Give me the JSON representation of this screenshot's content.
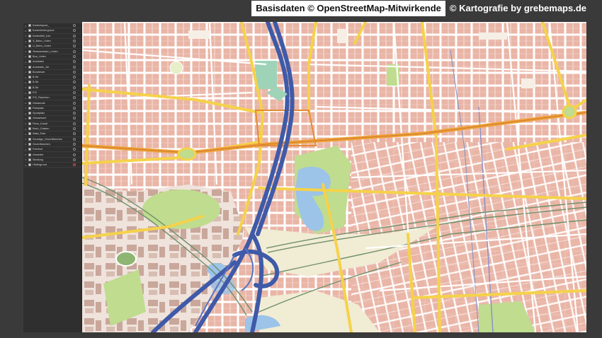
{
  "banner": {
    "base_data": "Basisdaten © OpenStreetMap-Mitwirkende",
    "cartography": "© Kartografie by grebemaps.de"
  },
  "layers_panel": {
    "items": [
      {
        "label": "Kartenlayout_"
      },
      {
        "label": "Kartenhintergrund"
      },
      {
        "label": "Kartentitel_Info"
      },
      {
        "label": "S_Bahn_Linien"
      },
      {
        "label": "U_Bahn_Linien"
      },
      {
        "label": "Strassenbahn_Linien"
      },
      {
        "label": "Bus_Linien"
      },
      {
        "label": "Autobahn"
      },
      {
        "label": "Autobahn_Ab"
      },
      {
        "label": "Bundesstr"
      },
      {
        "label": "B-Str"
      },
      {
        "label": "B-Str"
      },
      {
        "label": "B-Str"
      },
      {
        "label": "P/Z"
      },
      {
        "label": "P/Z_Flaechen"
      },
      {
        "label": "Gebaeude"
      },
      {
        "label": "Parkplatz"
      },
      {
        "label": "Sportplatz"
      },
      {
        "label": "Gewaesser"
      },
      {
        "label": "Fluss_Kanal"
      },
      {
        "label": "Bach_Graben"
      },
      {
        "label": "Wald_Park"
      },
      {
        "label": "Sonstige_Gruenflaechen"
      },
      {
        "label": "Gruenflaechen"
      },
      {
        "label": "Friedhof"
      },
      {
        "label": "Gewerbe"
      },
      {
        "label": "Siedlung"
      },
      {
        "label": "Hintergrund"
      }
    ]
  },
  "colors": {
    "building": "#e9b5a6",
    "road_white": "#ffffff",
    "road_yellow": "#f5d24a",
    "road_orange": "#f0a23a",
    "motorway": "#3f5aa8",
    "water": "#9cc3e8",
    "park": "#bfdc8f",
    "rail": "#6f8f6a",
    "rail_red": "#c44a4a",
    "commercial": "#c9a79b",
    "open_land": "#f1ecd4"
  },
  "map_content": {
    "water_bodies": 3,
    "parks": 6
  }
}
